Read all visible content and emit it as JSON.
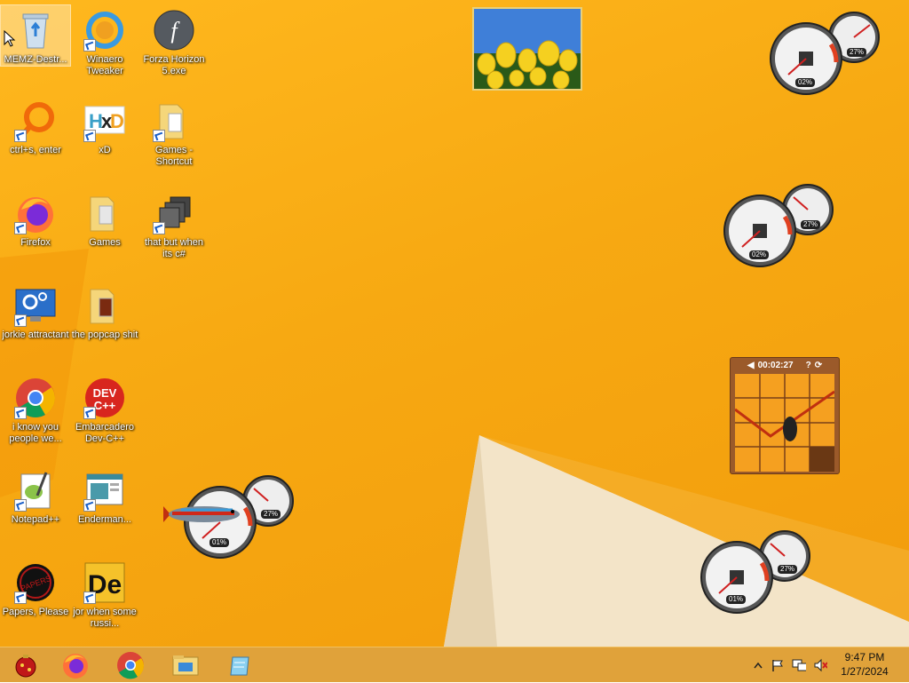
{
  "desktop": {
    "icons": [
      {
        "label": "MEMZ-Destr...",
        "icon": "recycle-bin-icon"
      },
      {
        "label": "Winaero Tweaker",
        "icon": "winaero-icon"
      },
      {
        "label": "Forza Horizon 5.exe",
        "icon": "flash-icon"
      },
      {
        "label": "ctrl+s, enter",
        "icon": "search-app-icon"
      },
      {
        "label": "xD",
        "icon": "hxd-icon"
      },
      {
        "label": "Games - Shortcut",
        "icon": "folder-icon"
      },
      {
        "label": "Firefox",
        "icon": "firefox-icon"
      },
      {
        "label": "Games",
        "icon": "folder-icon"
      },
      {
        "label": "that but when its c#",
        "icon": "windows-stack-icon"
      },
      {
        "label": "jorkie attractant",
        "icon": "settings-monitor-icon"
      },
      {
        "label": "the popcap shit",
        "icon": "folder-icon"
      },
      {
        "label": "i know you people we...",
        "icon": "chrome-icon"
      },
      {
        "label": "Embarcadero Dev-C++",
        "icon": "devcpp-icon"
      },
      {
        "label": "Notepad++",
        "icon": "notepadpp-icon"
      },
      {
        "label": "Enderman...",
        "icon": "app-window-icon"
      },
      {
        "label": "Papers, Please",
        "icon": "papers-please-icon"
      },
      {
        "label": "jor when some russi...",
        "icon": "de-icon"
      }
    ]
  },
  "gadgets": {
    "cpu_meters": [
      {
        "cpu": "02%",
        "mem": "27%"
      },
      {
        "cpu": "02%",
        "mem": "27%"
      },
      {
        "cpu": "01%",
        "mem": "27%"
      },
      {
        "cpu": "01%",
        "mem": "27%"
      }
    ],
    "puzzle_timer": "00:02:27"
  },
  "taskbar": {
    "apps": [
      "start-ornament-icon",
      "firefox-icon",
      "chrome-icon",
      "file-explorer-icon",
      "notepad-icon"
    ],
    "time": "9:47 PM",
    "date": "1/27/2024"
  },
  "colors": {
    "wallpaper": "#f7a912",
    "taskbar": "#e0a23a"
  }
}
